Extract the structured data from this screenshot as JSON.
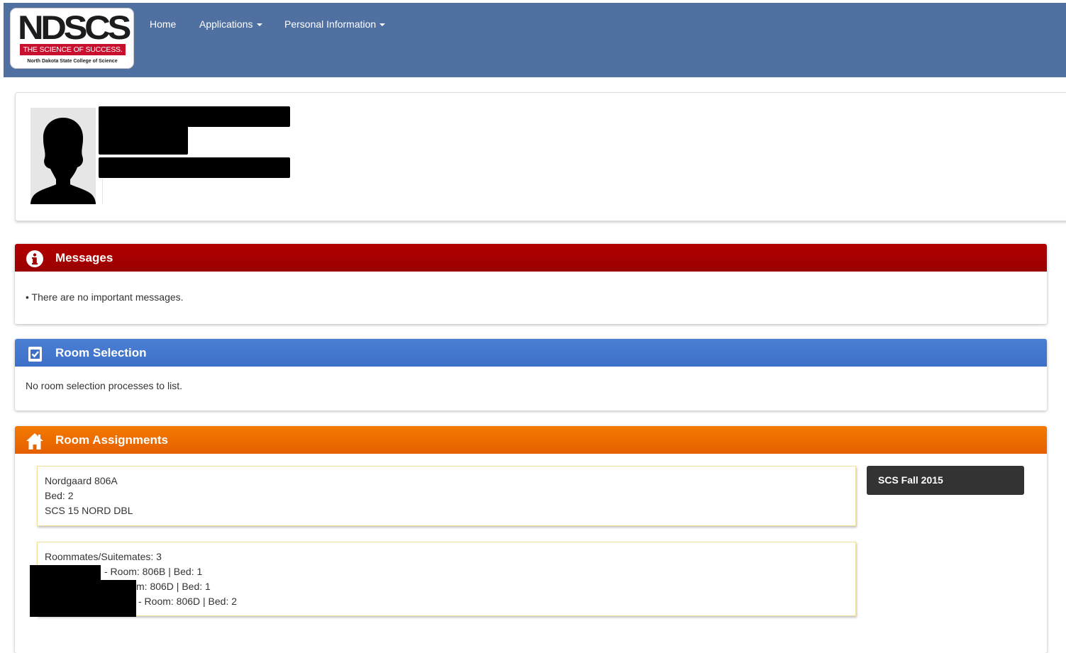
{
  "header": {
    "logo": {
      "mark": "NDSCS",
      "tagline": "THE SCIENCE OF SUCCESS.",
      "subtitle": "North Dakota State College of Science",
      "accent_color": "#c8102e"
    },
    "nav": [
      {
        "label": "Home",
        "has_dropdown": false
      },
      {
        "label": "Applications",
        "has_dropdown": true
      },
      {
        "label": "Personal Information",
        "has_dropdown": true
      }
    ],
    "background_color": "#5170a2"
  },
  "profile": {
    "avatar_icon": "person-silhouette-icon"
  },
  "messages": {
    "title": "Messages",
    "icon": "info-circle-icon",
    "text": "• There are no important messages.",
    "header_color": "#a30000"
  },
  "room_selection": {
    "title": "Room Selection",
    "icon": "checkbox-icon",
    "text": "No room selection processes to list.",
    "header_color": "#4477cc"
  },
  "room_assignments": {
    "title": "Room Assignments",
    "icon": "home-icon",
    "header_color": "#ee6c00",
    "assignment": {
      "room": "Nordgaard 806A",
      "bed": "Bed: 2",
      "rate": "SCS 15 NORD DBL"
    },
    "roommates": {
      "heading": "Roommates/Suitemates: 3",
      "list": [
        "- Room: 806B | Bed: 1",
        "m: 806D | Bed: 1",
        "- Room: 806D | Bed: 2"
      ]
    },
    "term": "SCS Fall 2015"
  }
}
